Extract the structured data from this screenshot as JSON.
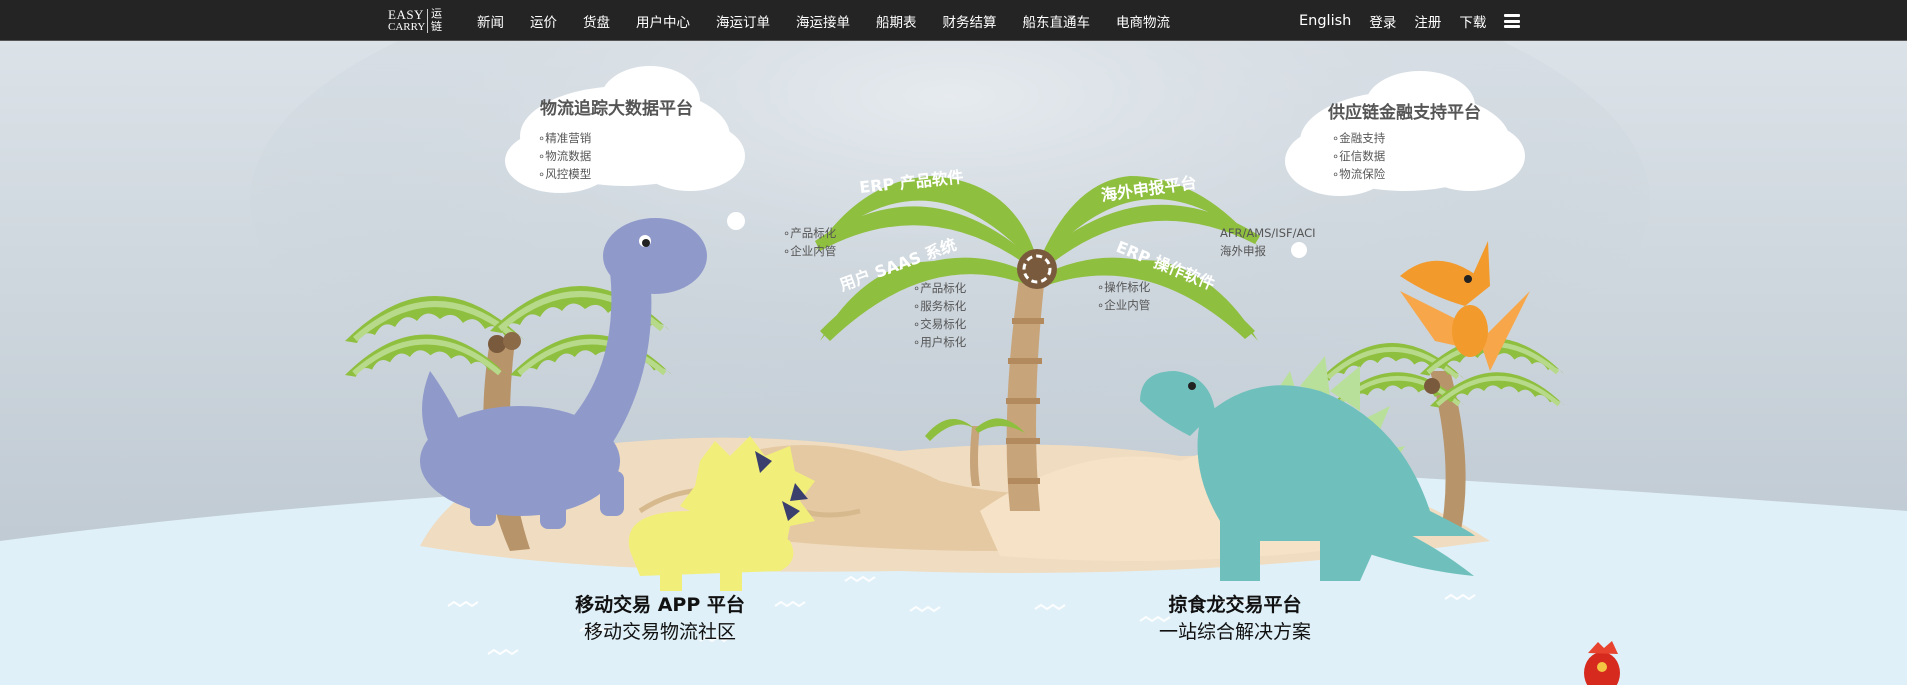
{
  "header": {
    "logo_top": "EASY",
    "logo_bottom": "CARRY",
    "logo_cn": "运链",
    "nav": [
      "新闻",
      "运价",
      "货盘",
      "用户中心",
      "海运订单",
      "海运接单",
      "船期表",
      "财务结算",
      "船东直通车",
      "电商物流"
    ],
    "right_links": [
      "English",
      "登录",
      "注册",
      "下载"
    ]
  },
  "clouds": {
    "left": {
      "title": "物流追踪大数据平台",
      "items": [
        "精准营销",
        "物流数据",
        "风控模型"
      ]
    },
    "right": {
      "title": "供应链金融支持平台",
      "items": [
        "金融支持",
        "征信数据",
        "物流保险"
      ]
    }
  },
  "palm": {
    "top_left_title": "ERP 产品软件",
    "top_left_items": [
      "产品标化",
      "企业内管"
    ],
    "top_right_title": "海外申报平台",
    "top_right_items": [
      "AFR/AMS/ISF/ACI",
      "海外申报"
    ],
    "bottom_left_title": "用户 SAAS 系统",
    "bottom_left_items": [
      "产品标化",
      "服务标化",
      "交易标化",
      "用户标化"
    ],
    "bottom_right_title": "ERP 操作软件",
    "bottom_right_items": [
      "操作标化",
      "企业内管"
    ]
  },
  "bottom": {
    "left_title": "移动交易 APP 平台",
    "left_sub": "移动交易物流社区",
    "right_title": "掠食龙交易平台",
    "right_sub": "一站综合解决方案"
  },
  "colors": {
    "header_bg": "#242424",
    "leaf": "#8fbf3e",
    "water": "#dff0f8"
  },
  "icons": [
    "menu-icon",
    "red-gift-bag-icon"
  ]
}
